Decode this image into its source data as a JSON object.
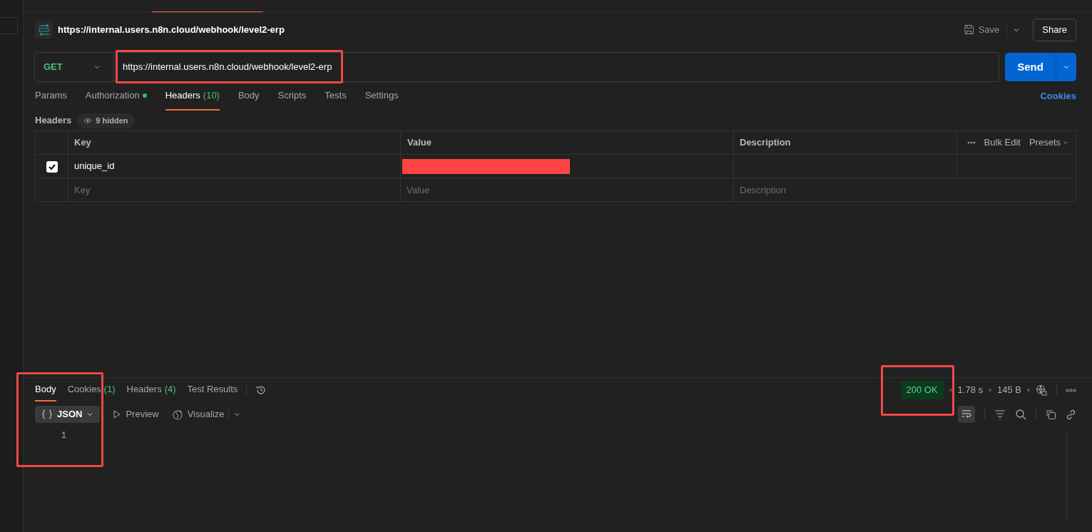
{
  "request": {
    "title": "https://internal.users.n8n.cloud/webhook/level2-erp",
    "save_label": "Save",
    "share_label": "Share",
    "method": "GET",
    "url": "https://internal.users.n8n.cloud/webhook/level2-erp",
    "url_highlighted": true,
    "send_label": "Send"
  },
  "request_tabs": [
    {
      "label": "Params",
      "selected": false,
      "indicator": false
    },
    {
      "label": "Authorization",
      "selected": false,
      "indicator": true
    },
    {
      "label": "Headers",
      "count": "(10)",
      "selected": true,
      "indicator": false
    },
    {
      "label": "Body",
      "selected": false,
      "indicator": false
    },
    {
      "label": "Scripts",
      "selected": false,
      "indicator": false
    },
    {
      "label": "Tests",
      "selected": false,
      "indicator": false
    },
    {
      "label": "Settings",
      "selected": false,
      "indicator": false
    }
  ],
  "cookies_link": "Cookies",
  "headers_section": {
    "label": "Headers",
    "hidden_badge": "9 hidden"
  },
  "headers_table": {
    "columns": [
      "Key",
      "Value",
      "Description"
    ],
    "bulk_edit": "Bulk Edit",
    "presets": "Presets",
    "rows": [
      {
        "checked": true,
        "key": "unique_id",
        "value_redacted": true
      }
    ],
    "new_row": {
      "key_placeholder": "Key",
      "value_placeholder": "Value",
      "description_placeholder": "Description"
    }
  },
  "response": {
    "tabs": [
      {
        "label": "Body",
        "selected": true
      },
      {
        "label": "Cookies",
        "count": "(1)",
        "selected": false
      },
      {
        "label": "Headers",
        "count": "(4)",
        "selected": false
      },
      {
        "label": "Test Results",
        "selected": false
      }
    ],
    "status": "200 OK",
    "status_highlighted": true,
    "time": "1.78 s",
    "size": "145 B",
    "formats": [
      {
        "label": "JSON",
        "selected": true
      },
      {
        "label": "Preview",
        "selected": false
      },
      {
        "label": "Visualize",
        "selected": false
      }
    ],
    "body_highlighted": true,
    "line_numbers": [
      "1"
    ]
  }
}
